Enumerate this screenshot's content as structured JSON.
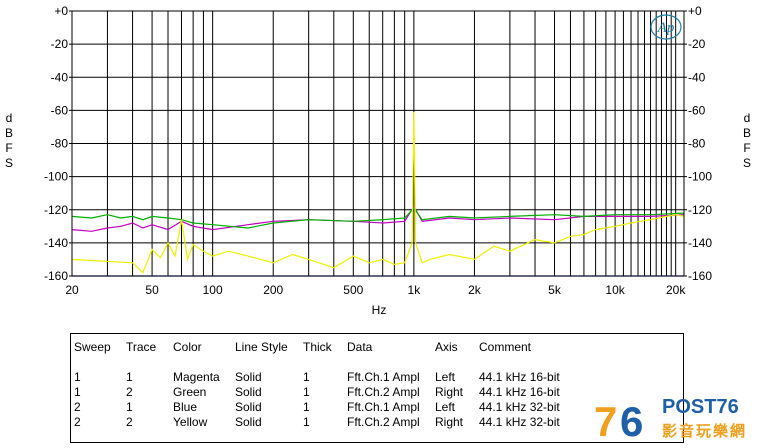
{
  "chart_data": {
    "type": "line",
    "title": "",
    "xlabel": "Hz",
    "ylabel_left": "dBFS",
    "ylabel_right": "dBFS",
    "x_scale": "log",
    "xlim": [
      20,
      22000
    ],
    "ylim": [
      -160,
      0
    ],
    "x_ticks": [
      {
        "value": 20,
        "label": "20"
      },
      {
        "value": 50,
        "label": "50"
      },
      {
        "value": 100,
        "label": "100"
      },
      {
        "value": 200,
        "label": "200"
      },
      {
        "value": 500,
        "label": "500"
      },
      {
        "value": 1000,
        "label": "1k"
      },
      {
        "value": 2000,
        "label": "2k"
      },
      {
        "value": 5000,
        "label": "5k"
      },
      {
        "value": 10000,
        "label": "10k"
      },
      {
        "value": 20000,
        "label": "20k"
      }
    ],
    "y_ticks_left": [
      "+0",
      "-20",
      "-40",
      "-60",
      "-80",
      "-100",
      "-120",
      "-140",
      "-160"
    ],
    "y_ticks_right": [
      "+0",
      "-20",
      "-40",
      "-60",
      "-80",
      "-100",
      "-120",
      "-140",
      "-160"
    ],
    "grid": true,
    "series": [
      {
        "name": "Magenta",
        "color": "#c000c0",
        "x": [
          20,
          25,
          30,
          35,
          40,
          45,
          50,
          60,
          70,
          80,
          100,
          150,
          200,
          300,
          500,
          700,
          900,
          1000,
          1100,
          1500,
          2000,
          3000,
          5000,
          7000,
          10000,
          15000,
          22000
        ],
        "y": [
          -132,
          -133,
          -131,
          -130,
          -128,
          -131,
          -129,
          -132,
          -127,
          -130,
          -132,
          -129,
          -127,
          -126,
          -127,
          -128,
          -127,
          -118,
          -127,
          -125,
          -126,
          -125,
          -126,
          -124,
          -124,
          -124,
          -123
        ]
      },
      {
        "name": "Green",
        "color": "#00b000",
        "x": [
          20,
          25,
          30,
          35,
          40,
          45,
          50,
          60,
          70,
          80,
          100,
          150,
          200,
          300,
          500,
          700,
          900,
          1000,
          1100,
          1500,
          2000,
          3000,
          5000,
          7000,
          10000,
          15000,
          22000
        ],
        "y": [
          -124,
          -125,
          -123,
          -125,
          -124,
          -126,
          -124,
          -125,
          -126,
          -128,
          -129,
          -131,
          -128,
          -126,
          -127,
          -126,
          -125,
          -119,
          -126,
          -124,
          -125,
          -124,
          -123,
          -124,
          -123,
          -123,
          -122
        ]
      },
      {
        "name": "Blue",
        "color": "#2040d0",
        "x": [
          20,
          30,
          50,
          100,
          200,
          500,
          1000,
          2000,
          5000,
          10000,
          22000
        ],
        "y": [
          -170,
          -170,
          -170,
          -170,
          -170,
          -170,
          -170,
          -170,
          -170,
          -170,
          -170
        ]
      },
      {
        "name": "Yellow",
        "color": "#f0f000",
        "x": [
          20,
          40,
          45,
          50,
          55,
          60,
          65,
          70,
          75,
          80,
          90,
          100,
          120,
          150,
          200,
          250,
          300,
          400,
          500,
          600,
          700,
          800,
          900,
          980,
          1000,
          1020,
          1100,
          1200,
          1500,
          2000,
          2500,
          3000,
          4000,
          5000,
          6000,
          7000,
          8000,
          10000,
          12000,
          15000,
          18000,
          20000,
          22000
        ],
        "y": [
          -150,
          -152,
          -158,
          -144,
          -149,
          -140,
          -148,
          -126,
          -150,
          -141,
          -145,
          -148,
          -145,
          -148,
          -152,
          -147,
          -150,
          -155,
          -148,
          -152,
          -150,
          -153,
          -152,
          -140,
          -61,
          -140,
          -152,
          -150,
          -147,
          -150,
          -142,
          -145,
          -138,
          -140,
          -136,
          -135,
          -132,
          -130,
          -128,
          -126,
          -124,
          -123,
          -124
        ]
      }
    ]
  },
  "legend": {
    "headers": [
      "Sweep",
      "Trace",
      "Color",
      "Line Style",
      "Thick",
      "Data",
      "Axis",
      "Comment"
    ],
    "rows": [
      [
        "1",
        "1",
        "Magenta",
        "Solid",
        "1",
        "Fft.Ch.1 Ampl",
        "Left",
        "44.1 kHz 16-bit"
      ],
      [
        "1",
        "2",
        "Green",
        "Solid",
        "1",
        "Fft.Ch.2 Ampl",
        "Right",
        "44.1 kHz 16-bit"
      ],
      [
        "2",
        "1",
        "Blue",
        "Solid",
        "1",
        "Fft.Ch.1 Ampl",
        "Left",
        "44.1 kHz 32-bit"
      ],
      [
        "2",
        "2",
        "Yellow",
        "Solid",
        "1",
        "Fft.Ch.2 Ampl",
        "Right",
        "44.1 kHz 32-bit"
      ]
    ]
  },
  "logo": {
    "text": "Ap"
  },
  "watermark": {
    "text": "POST76",
    "sub": "影音玩樂網"
  },
  "colors": {
    "grid": "#000000",
    "logo": "#1f7fa8",
    "watermark_blue": "#1f5fa8",
    "watermark_orange": "#f0a020"
  }
}
